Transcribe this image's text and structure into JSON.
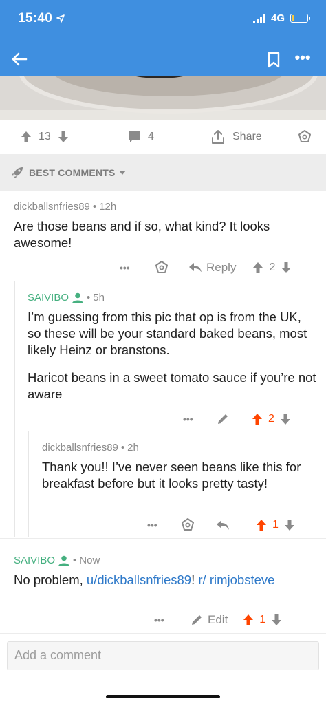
{
  "status": {
    "time": "15:40",
    "network": "4G"
  },
  "post": {
    "upvotes": "13",
    "comments": "4",
    "share_label": "Share"
  },
  "sort": {
    "label": "BEST COMMENTS"
  },
  "comments": [
    {
      "author": "dickballsnfries89",
      "age": "12h",
      "body": "Are those beans and if so, what kind? It looks awesome!",
      "reply_label": "Reply",
      "score": "2"
    },
    {
      "author": "SAIVIBO",
      "age": "5h",
      "body1": "I’m guessing from this pic that op is from the UK, so these will be your standard baked beans, most likely Heinz or branstons.",
      "body2": "Haricot beans in a sweet tomato sauce if you’re not aware",
      "score": "2"
    },
    {
      "author": "dickballsnfries89",
      "age": "2h",
      "body": "Thank you!! I’ve never seen beans like this for breakfast before but it looks pretty tasty!",
      "score": "1"
    },
    {
      "author": "SAIVIBO",
      "age": "Now",
      "body_pre": "No problem, ",
      "mention_user": "u/dickballsnfries89",
      "body_mid": "! ",
      "mention_sub": "r/ rimjobsteve",
      "edit_label": "Edit",
      "score": "1"
    }
  ],
  "composer": {
    "placeholder": "Add a comment"
  },
  "colors": {
    "appbar": "#3f8fe0",
    "op_green": "#46b080",
    "upvoted": "#ff4500",
    "link": "#2e79c9"
  }
}
